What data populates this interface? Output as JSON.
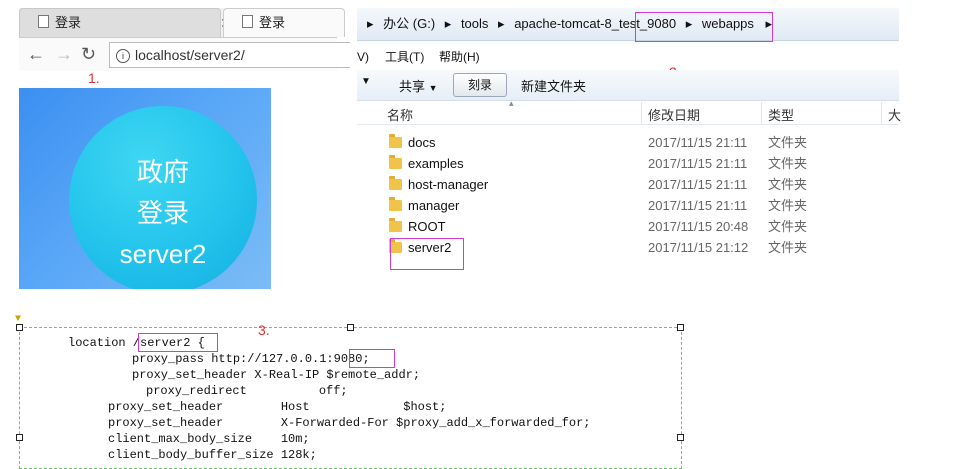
{
  "browser": {
    "tabs": [
      {
        "label": "登录"
      },
      {
        "label": "登录"
      }
    ],
    "url": "localhost/server2/"
  },
  "annotations": {
    "one": "1.",
    "two": "2.",
    "three": "3."
  },
  "login_banner": {
    "line1": "政府",
    "line2": "登录",
    "line3": "server2"
  },
  "explorer": {
    "breadcrumb": [
      "办公 (G:)",
      "tools",
      "apache-tomcat-8_test_9080",
      "webapps"
    ],
    "menu": {
      "left_fragment": "V)",
      "tools": "工具(T)",
      "help": "帮助(H)"
    },
    "toolbar": {
      "share": "共享",
      "burn": "刻录",
      "new_folder": "新建文件夹"
    },
    "columns": {
      "name": "名称",
      "date": "修改日期",
      "type": "类型",
      "size": "大"
    },
    "files": [
      {
        "name": "docs",
        "date": "2017/11/15 21:11",
        "type": "文件夹"
      },
      {
        "name": "examples",
        "date": "2017/11/15 21:11",
        "type": "文件夹"
      },
      {
        "name": "host-manager",
        "date": "2017/11/15 21:11",
        "type": "文件夹"
      },
      {
        "name": "manager",
        "date": "2017/11/15 21:11",
        "type": "文件夹"
      },
      {
        "name": "ROOT",
        "date": "2017/11/15 20:48",
        "type": "文件夹"
      },
      {
        "name": "server2",
        "date": "2017/11/15 21:12",
        "type": "文件夹"
      }
    ]
  },
  "config": {
    "lines": [
      "location /server2 {",
      "proxy_pass http://127.0.0.1:9080;",
      "proxy_set_header X-Real-IP $remote_addr;",
      "proxy_redirect          off;",
      "proxy_set_header        Host             $host;",
      "proxy_set_header        X-Forwarded-For $proxy_add_x_forwarded_for;",
      "client_max_body_size    10m;",
      "client_body_buffer_size 128k;"
    ]
  },
  "colors": {
    "annotation_red": "#e0302f",
    "highlight_magenta": "#d23bd2",
    "selection_green": "#6cc56c"
  }
}
